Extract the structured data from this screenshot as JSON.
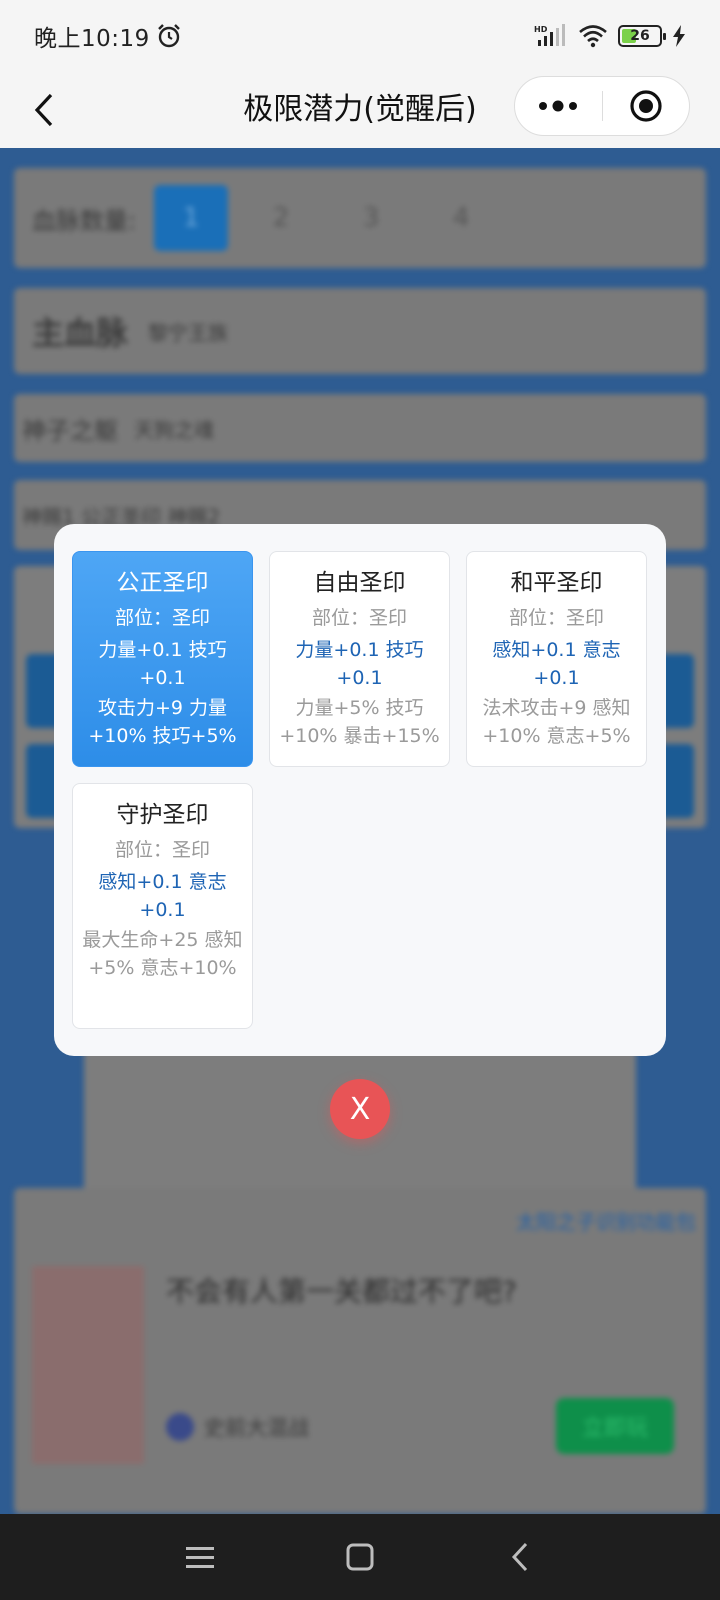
{
  "status_bar": {
    "time": "晚上10:19",
    "icons": [
      "alarm-icon",
      "hd-signal-icon",
      "wifi-icon",
      "battery-icon",
      "charging-icon"
    ],
    "battery_level": "26"
  },
  "title_bar": {
    "title": "极限潜力(觉醒后)",
    "icons": [
      "back-icon",
      "more-dots-icon",
      "target-icon"
    ]
  },
  "background_page": {
    "bloodline_count_label": "血脉数量:",
    "bloodline_tabs": [
      "1",
      "2",
      "3",
      "4"
    ],
    "selected_tab": "1",
    "main_bloodline_label": "主血脉",
    "main_bloodline_value": "黎宁王族",
    "god_child_label": "神子之躯",
    "god_child_value": "天狗之魂",
    "divine_row_text": "神赐1 公正圣印 神赐2",
    "ad_link": "太阳之子识别功能包",
    "ad_title": "不会有人第一关都过不了吧?",
    "ad_source": "史前大混战",
    "ad_button": "立即玩"
  },
  "dialog": {
    "cards": [
      {
        "name": "公正圣印",
        "position": "部位：圣印",
        "attributes": "力量+0.1 技巧+0.1",
        "bonus": "攻击力+9 力量+10% 技巧+5%",
        "selected": true
      },
      {
        "name": "自由圣印",
        "position": "部位：圣印",
        "attributes": "力量+0.1 技巧+0.1",
        "bonus": "力量+5% 技巧+10% 暴击+15%",
        "selected": false
      },
      {
        "name": "和平圣印",
        "position": "部位：圣印",
        "attributes": "感知+0.1 意志+0.1",
        "bonus": "法术攻击+9 感知+10% 意志+5%",
        "selected": false
      },
      {
        "name": "守护圣印",
        "position": "部位：圣印",
        "attributes": "感知+0.1 意志+0.1",
        "bonus": "最大生命+25 感知+5% 意志+10%",
        "selected": false
      }
    ],
    "close_label": "X",
    "colors": {
      "selected_card": "#3a95ef",
      "attribute_text": "#1e64b4",
      "close_button": "#e85456"
    }
  },
  "nav_bar": {
    "icons": [
      "menu-icon",
      "home-square-icon",
      "back-triangle-icon"
    ]
  }
}
